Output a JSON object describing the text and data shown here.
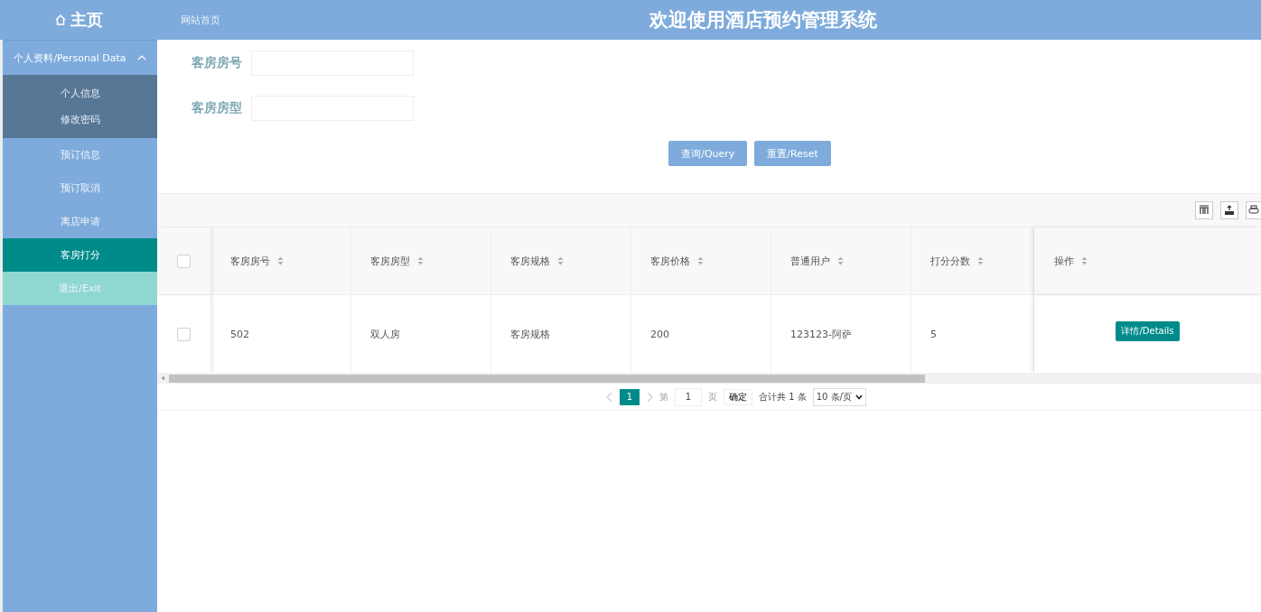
{
  "header": {
    "home": "主页",
    "breadcrumb": "网站首页",
    "title": "欢迎使用酒店预约管理系统"
  },
  "sidebar": {
    "items": [
      {
        "label": "个人资料/Personal Data",
        "kind": "group",
        "expanded": true,
        "children": [
          {
            "label": "个人信息",
            "selected": false
          },
          {
            "label": "修改密码",
            "selected": false
          }
        ]
      },
      {
        "label": "预订信息",
        "kind": "link",
        "selected": false
      },
      {
        "label": "预订取消",
        "kind": "link",
        "selected": false
      },
      {
        "label": "离店申请",
        "kind": "link",
        "selected": false
      },
      {
        "label": "客房打分",
        "kind": "link",
        "selected": true
      },
      {
        "label": "退出/Exit",
        "kind": "exit",
        "selected": false
      }
    ]
  },
  "search": {
    "fields": [
      {
        "label": "客房房号"
      },
      {
        "label": "客房房型"
      }
    ],
    "buttons": [
      "查询/Query",
      "重置/Reset"
    ]
  },
  "table": {
    "select_all_checked": false,
    "columns": [
      "客房房号",
      "客房房型",
      "客房规格",
      "客房价格",
      "普通用户",
      "打分分数"
    ],
    "action_column": "操作",
    "rows": [
      {
        "checked": false,
        "cells": [
          "502",
          "双人房",
          "客房规格",
          "200",
          "123123-阿萨",
          "5"
        ],
        "action": "详情/Details"
      }
    ]
  },
  "pagination": {
    "pages": [
      {
        "label": "1",
        "selected": true
      }
    ],
    "goto_prefix": "第",
    "goto_value": "1",
    "goto_suffix": "页",
    "confirm": "确定",
    "total": "合计共 1 条",
    "page_size": "10 条/页"
  }
}
